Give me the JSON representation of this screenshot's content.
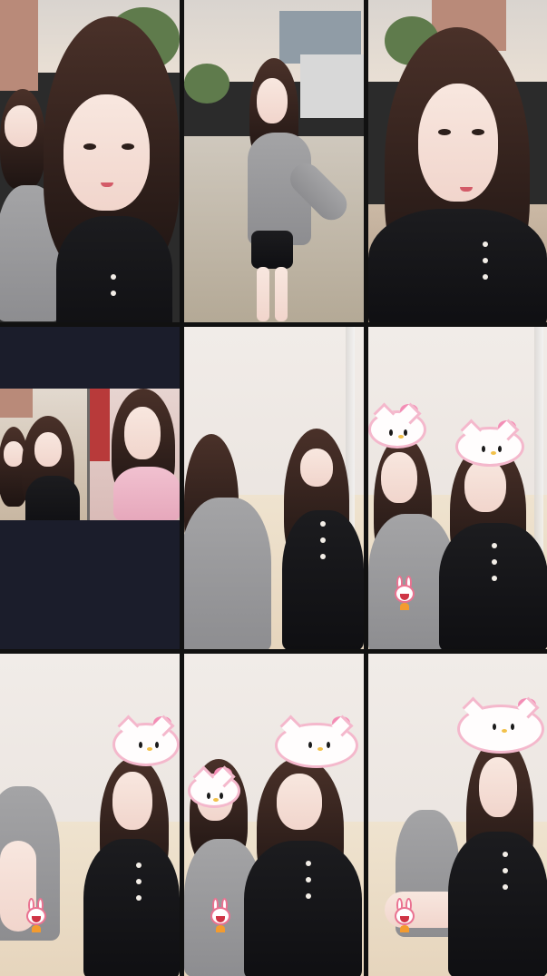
{
  "window": {
    "title": ""
  },
  "grid": {
    "tiles": [
      {
        "id": "tile-1",
        "scene": "outdoor-duo-closeup"
      },
      {
        "id": "tile-2",
        "scene": "outdoor-fullbody"
      },
      {
        "id": "tile-3",
        "scene": "outdoor-closeup"
      },
      {
        "id": "tile-4",
        "scene": "picture-in-picture-dark"
      },
      {
        "id": "tile-5",
        "scene": "indoor-duo"
      },
      {
        "id": "tile-6",
        "scene": "indoor-duo-sticker"
      },
      {
        "id": "tile-7",
        "scene": "indoor-solo-sticker"
      },
      {
        "id": "tile-8",
        "scene": "indoor-duo-sticker"
      },
      {
        "id": "tile-9",
        "scene": "indoor-solo-sticker"
      }
    ]
  },
  "colors": {
    "background": "#111111",
    "dark_panel": "#1b1d2b",
    "accent_pink": "#f38db5"
  },
  "icons": {
    "sticker_1": "hello-kitty-sticker-icon",
    "sticker_2": "rabbit-sticker-icon"
  }
}
